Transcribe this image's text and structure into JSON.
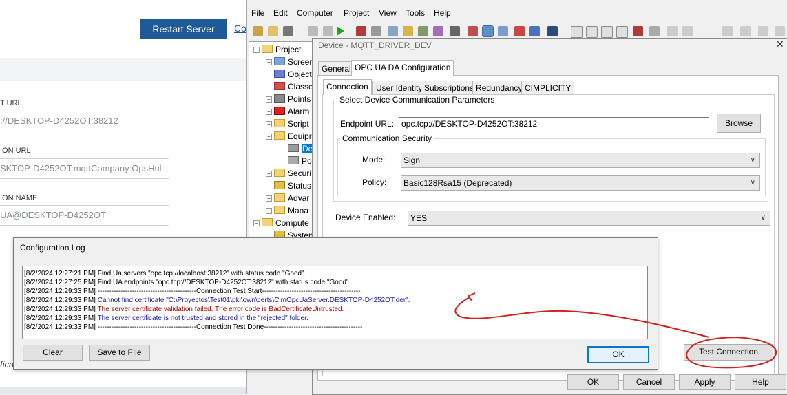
{
  "web": {
    "restart_label": "Restart Server",
    "config_link": "Co",
    "fields": [
      {
        "label": "T URL",
        "value": "://DESKTOP-D4252OT:38212"
      },
      {
        "label": "ION URL",
        "value": "SKTOP-D4252OT:mqttCompany:OpsHul"
      },
      {
        "label": "ION NAME",
        "value": "UA@DESKTOP-D4252OT"
      }
    ],
    "cut_text": "fica"
  },
  "app": {
    "menu": [
      "File",
      "Edit",
      "Computer",
      "Project",
      "View",
      "Tools",
      "Help"
    ],
    "tree": {
      "items": [
        {
          "label": "Project",
          "level": 0
        },
        {
          "label": "Screen",
          "level": 1
        },
        {
          "label": "Object",
          "level": 1
        },
        {
          "label": "Classe",
          "level": 1
        },
        {
          "label": "Points",
          "level": 1
        },
        {
          "label": "Alarm",
          "level": 1
        },
        {
          "label": "Script",
          "level": 1
        },
        {
          "label": "Equipr",
          "level": 1
        },
        {
          "label": "De",
          "level": 2
        },
        {
          "label": "Po",
          "level": 2
        },
        {
          "label": "Securi",
          "level": 1
        },
        {
          "label": "Status",
          "level": 1
        },
        {
          "label": "Advar",
          "level": 1
        },
        {
          "label": "Mana",
          "level": 1
        },
        {
          "label": "Compute",
          "level": 0
        },
        {
          "label": "Systen",
          "level": 1
        }
      ]
    }
  },
  "device_dialog": {
    "title": "Device - MQTT_DRIVER_DEV",
    "close": "✕",
    "outer_tabs": [
      "General",
      "OPC UA DA Configuration"
    ],
    "inner_tabs": [
      "Connection",
      "User Identity",
      "Subscriptions",
      "Redundancy",
      "CIMPLICITY"
    ],
    "group_title": "Select Device Communication Parameters",
    "endpoint_label": "Endpoint URL:",
    "endpoint_value": "opc.tcp://DESKTOP-D4252OT:38212",
    "browse_label": "Browse",
    "security_title": "Communication Security",
    "mode_label": "Mode:",
    "mode_value": "Sign",
    "policy_label": "Policy:",
    "policy_value": "Basic128Rsa15 (Deprecated)",
    "enabled_label": "Device Enabled:",
    "enabled_value": "YES",
    "test_connection_label": "Test Connection",
    "buttons": {
      "ok": "OK",
      "cancel": "Cancel",
      "apply": "Apply",
      "help": "Help"
    }
  },
  "config_log": {
    "title": "Configuration Log",
    "lines": [
      {
        "ts": "[8/2/2024 12:27:21 PM]",
        "text": "Find Ua servers \"opc.tcp://localhost:38212\" with status code \"Good\".",
        "color": "#000000"
      },
      {
        "ts": "[8/2/2024 12:27:25 PM]",
        "text": "Find UA endpoints \"opc.tcp://DESKTOP-D4252OT:38212\" with status code \"Good\".",
        "color": "#000000"
      },
      {
        "ts": "[8/2/2024 12:29:33 PM]",
        "text": "-------------------------------------------Connection Test Start-------------------------------------------",
        "color": "#000000"
      },
      {
        "ts": "[8/2/2024 12:29:33 PM]",
        "text": "Cannot find certificate \"C:\\Proyectos\\Test01\\pki\\own\\certs\\CimOpcUaServer.DESKTOP-D4252OT.der\".",
        "color": "#1a1aa6"
      },
      {
        "ts": "[8/2/2024 12:29:33 PM]",
        "text": "The server certificate validation failed. The error code is BadCertificateUntrusted.",
        "color": "#b00000"
      },
      {
        "ts": "[8/2/2024 12:29:33 PM]",
        "text": "The server certificate is not trusted and stored in the \"rejected\" folder.",
        "color": "#1a1aa6"
      },
      {
        "ts": "[8/2/2024 12:29:33 PM]",
        "text": "-------------------------------------------Connection Test Done-------------------------------------------",
        "color": "#000000"
      }
    ],
    "clear_label": "Clear",
    "save_label": "Save to FIle",
    "ok_label": "OK"
  },
  "colors": {
    "accent": "#1d5a96",
    "annotation": "#d61f1f",
    "selection": "#0078d7"
  }
}
